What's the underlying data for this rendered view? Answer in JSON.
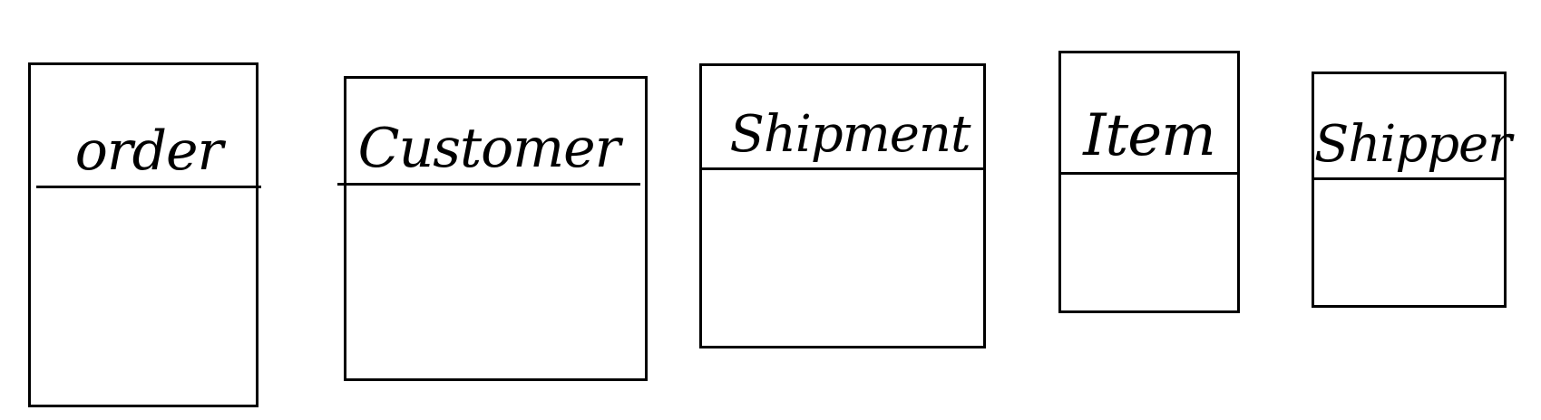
{
  "diagram": {
    "entities": [
      {
        "name": "order"
      },
      {
        "name": "Customer"
      },
      {
        "name": "Shipment"
      },
      {
        "name": "Item"
      },
      {
        "name": "Shipper"
      }
    ]
  }
}
